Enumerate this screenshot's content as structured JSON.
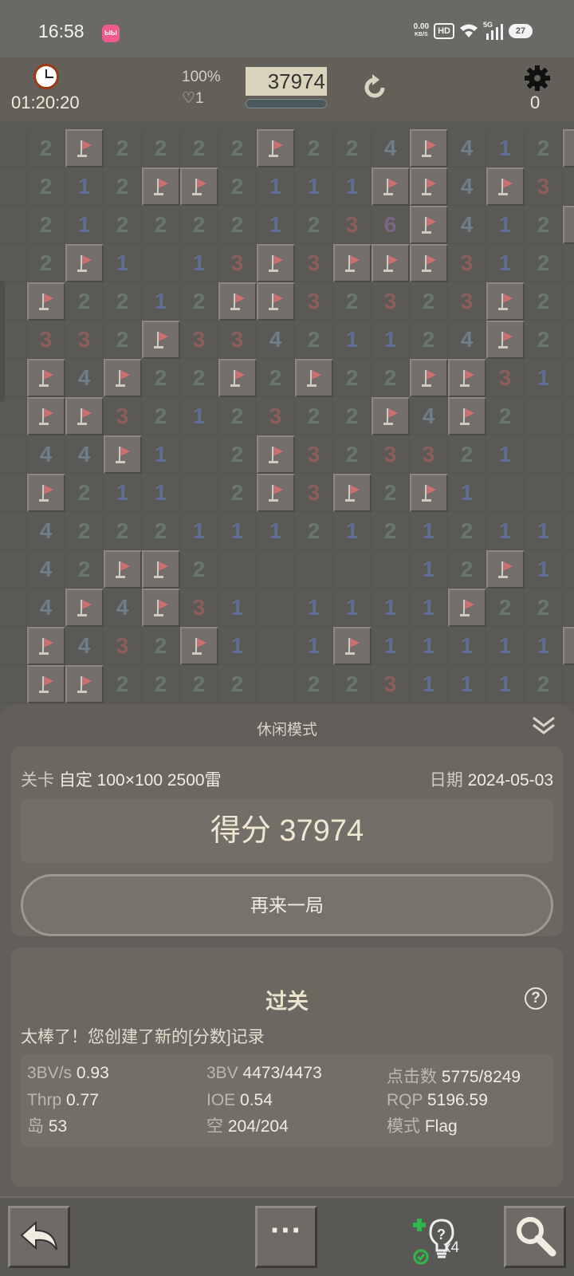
{
  "status_bar": {
    "time": "16:58",
    "app_badge": "ЫЫ",
    "net_speed_top": "0.00",
    "net_speed_bottom": "KB/S",
    "hd_label": "HD",
    "signal_label": "5G",
    "battery_level": "27"
  },
  "header": {
    "elapsed": "01:20:20",
    "progress_pct": "100%",
    "lives": "♡1",
    "score": "37974",
    "progress_fraction": 1.0,
    "settings_count": "0"
  },
  "board": {
    "rows": [
      [
        "",
        "2",
        "F",
        "2",
        "2",
        "2",
        "2",
        "F",
        "2",
        "2",
        "4",
        "F",
        "4",
        "1",
        "2",
        "F"
      ],
      [
        "",
        "2",
        "1",
        "2",
        "F",
        "F",
        "2",
        "1",
        "1",
        "1",
        "F",
        "F",
        "4",
        "F",
        "3",
        "2"
      ],
      [
        "",
        "2",
        "1",
        "2",
        "2",
        "2",
        "2",
        "1",
        "2",
        "3",
        "6",
        "F",
        "4",
        "1",
        "2",
        "F"
      ],
      [
        "",
        "2",
        "F",
        "1",
        "",
        "1",
        "3",
        "F",
        "3",
        "F",
        "F",
        "F",
        "3",
        "1",
        "2",
        "1"
      ],
      [
        "",
        "F",
        "2",
        "2",
        "1",
        "2",
        "F",
        "F",
        "3",
        "2",
        "3",
        "2",
        "3",
        "F",
        "2",
        ""
      ],
      [
        "",
        "3",
        "3",
        "2",
        "F",
        "3",
        "3",
        "4",
        "2",
        "1",
        "1",
        "2",
        "4",
        "F",
        "2",
        "1"
      ],
      [
        "",
        "F",
        "4",
        "F",
        "2",
        "2",
        "F",
        "2",
        "F",
        "2",
        "2",
        "F",
        "F",
        "3",
        "1",
        "2"
      ],
      [
        "",
        "F",
        "F",
        "3",
        "2",
        "1",
        "2",
        "3",
        "2",
        "2",
        "F",
        "4",
        "F",
        "2",
        "",
        "3"
      ],
      [
        "",
        "4",
        "4",
        "F",
        "1",
        "",
        "2",
        "F",
        "3",
        "2",
        "3",
        "3",
        "2",
        "1",
        "",
        "2"
      ],
      [
        "",
        "F",
        "2",
        "1",
        "1",
        "",
        "2",
        "F",
        "3",
        "F",
        "2",
        "F",
        "1",
        "",
        "",
        "1"
      ],
      [
        "",
        "4",
        "2",
        "2",
        "2",
        "1",
        "1",
        "1",
        "2",
        "1",
        "2",
        "1",
        "2",
        "1",
        "1",
        "1"
      ],
      [
        "",
        "4",
        "2",
        "F",
        "F",
        "2",
        "",
        "",
        "",
        "",
        "",
        "1",
        "2",
        "F",
        "1",
        "1"
      ],
      [
        "",
        "4",
        "F",
        "4",
        "F",
        "3",
        "1",
        "",
        "1",
        "1",
        "1",
        "1",
        "F",
        "2",
        "2",
        "3"
      ],
      [
        "",
        "F",
        "4",
        "3",
        "2",
        "F",
        "1",
        "",
        "1",
        "F",
        "1",
        "1",
        "1",
        "1",
        "1",
        "F"
      ],
      [
        "",
        "F",
        "F",
        "2",
        "2",
        "2",
        "2",
        "",
        "2",
        "2",
        "3",
        "1",
        "1",
        "1",
        "2",
        "3"
      ]
    ]
  },
  "panel": {
    "mode_title": "休闲模式",
    "level_label": "关卡",
    "level_value": "自定 100×100  2500雷",
    "date_label": "日期",
    "date_value": "2024-05-03",
    "score_text": "得分 37974",
    "play_again": "再来一局",
    "pass_title": "过关",
    "pass_message": "太棒了！您创建了新的[分数]记录",
    "help": "?",
    "stats": [
      {
        "label": "3BV/s",
        "value": "0.93"
      },
      {
        "label": "3BV",
        "value": "4473/4473"
      },
      {
        "label": "点击数",
        "value": "5775/8249"
      },
      {
        "label": "Thrp",
        "value": "0.77"
      },
      {
        "label": "IOE",
        "value": "0.54"
      },
      {
        "label": "RQP",
        "value": "5196.59"
      },
      {
        "label": "岛",
        "value": "53"
      },
      {
        "label": "空",
        "value": "204/204"
      },
      {
        "label": "模式",
        "value": "Flag"
      }
    ]
  },
  "toolbar": {
    "more_label": "···",
    "hint_count": "x4"
  },
  "icons": {
    "timer": "alarm-clock-icon",
    "undo": "restart-icon",
    "settings": "gear-icon",
    "collapse": "double-chevron-down-icon",
    "back": "back-arrow-icon",
    "hint": "hint-bulb-icon",
    "search": "magnifier-icon"
  }
}
